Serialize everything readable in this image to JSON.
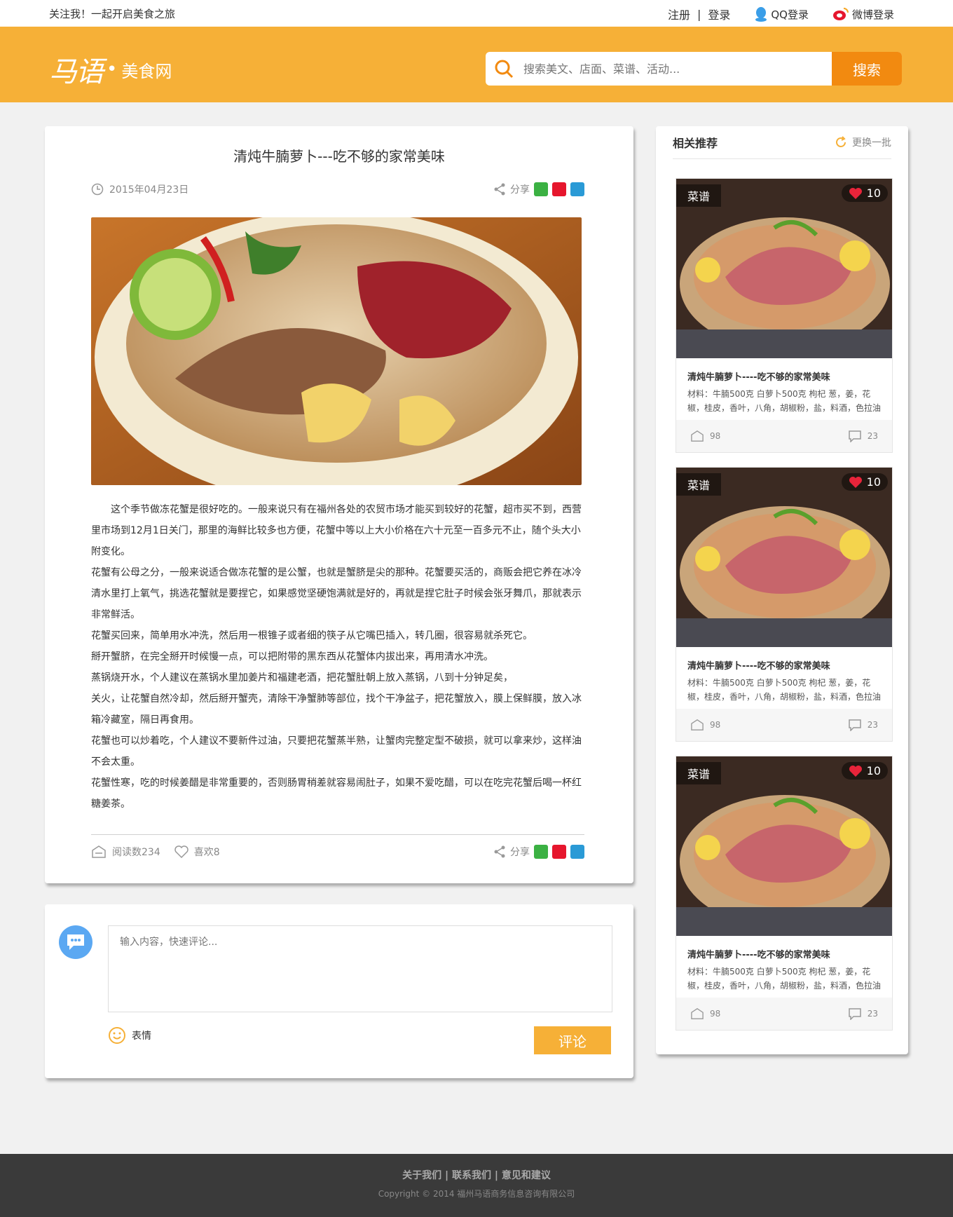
{
  "topbar": {
    "follow": "关注我！一起开启美食之旅",
    "register": "注册",
    "login": "登录",
    "qq_login": "QQ登录",
    "weibo_login": "微博登录"
  },
  "header": {
    "logo_mark": "马语",
    "logo_name": "美食网",
    "search_placeholder": "搜索美文、店面、菜谱、活动...",
    "search_button": "搜索"
  },
  "article": {
    "title": "清炖牛腩萝卜---吃不够的家常美味",
    "date": "2015年04月23日",
    "share_label": "分享",
    "paragraphs": [
      "这个季节做冻花蟹是很好吃的。一般来说只有在福州各处的农贸市场才能买到较好的花蟹，超市买不到，西营里市场到12月1日关门，那里的海鲜比较多也方便，花蟹中等以上大小价格在六十元至一百多元不止，随个头大小附变化。",
      "花蟹有公母之分，一般来说适合做冻花蟹的是公蟹，也就是蟹脐是尖的那种。花蟹要买活的，商贩会把它养在冰冷清水里打上氧气，挑选花蟹就是要捏它，如果感觉坚硬饱满就是好的，再就是捏它肚子时候会张牙舞爪，那就表示非常鲜活。",
      "花蟹买回来，简单用水冲洗，然后用一根锥子或者细的筷子从它嘴巴插入，转几圈，很容易就杀死它。",
      "掰开蟹脐，在完全掰开时候慢一点，可以把附带的黑东西从花蟹体内拔出来，再用清水冲洗。",
      "蒸锅烧开水，个人建议在蒸锅水里加姜片和福建老酒，把花蟹肚朝上放入蒸锅，八到十分钟足矣，",
      "关火，让花蟹自然冷却，然后掰开蟹壳，清除干净蟹肺等部位，找个干净盆子，把花蟹放入，膜上保鲜膜，放入冰箱冷藏室，隔日再食用。",
      "花蟹也可以炒着吃，个人建议不要新件过油，只要把花蟹蒸半熟，让蟹肉完整定型不破损，就可以拿来炒，这样油不会太重。",
      "花蟹性寒，吃的时候姜醋是非常重要的，否则肠胃稍差就容易闹肚子，如果不爱吃醋，可以在吃完花蟹后喝一杯红糖姜茶。"
    ],
    "reads": "阅读数234",
    "likes": "喜欢8",
    "share_label_footer": "分享"
  },
  "comment": {
    "placeholder": "输入内容，快速评论...",
    "emoji_label": "表情",
    "submit": "评论"
  },
  "sidebar": {
    "title": "相关推荐",
    "refresh": "更换一批",
    "cards": [
      {
        "tag": "菜谱",
        "likes": "10",
        "title": "清炖牛腩萝卜----吃不够的家常美味",
        "desc": "材料：牛腩500克 白萝卜500克 枸杞 葱，姜，花椒，桂皮，香叶，八角，胡椒粉，盐，料酒，色拉油",
        "views": "98",
        "comments": "23"
      },
      {
        "tag": "菜谱",
        "likes": "10",
        "title": "清炖牛腩萝卜----吃不够的家常美味",
        "desc": "材料：牛腩500克 白萝卜500克 枸杞 葱，姜，花椒，桂皮，香叶，八角，胡椒粉，盐，料酒，色拉油",
        "views": "98",
        "comments": "23"
      },
      {
        "tag": "菜谱",
        "likes": "10",
        "title": "清炖牛腩萝卜----吃不够的家常美味",
        "desc": "材料：牛腩500克 白萝卜500克 枸杞 葱，姜，花椒，桂皮，香叶，八角，胡椒粉，盐，料酒，色拉油",
        "views": "98",
        "comments": "23"
      }
    ]
  },
  "footer": {
    "links": "关于我们 | 联系我们 | 意见和建议",
    "copyright": "Copyright © 2014 福州马语商务信息咨询有限公司"
  },
  "colors": {
    "brand": "#f6b037",
    "search_button": "#f28a10",
    "page_bg": "#f1f1f1",
    "footer_bg": "#3a3a3a"
  }
}
